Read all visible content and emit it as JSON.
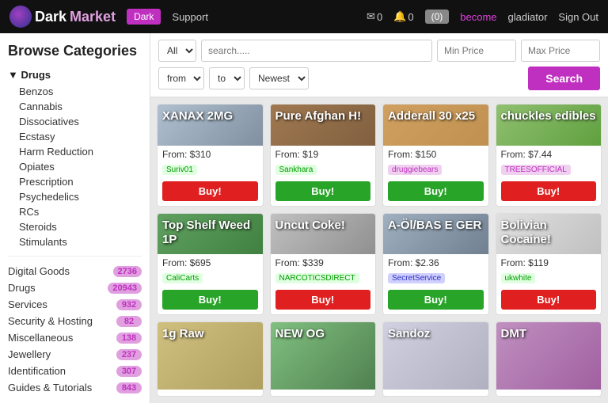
{
  "header": {
    "logo_dark": "Dark",
    "logo_market": "Market",
    "nav_dark": "Dark",
    "nav_support": "Support",
    "mail_count": "0",
    "bell_count": "0",
    "cart_label": "(0)",
    "become": "become",
    "username": "gladiator",
    "signout": "Sign Out"
  },
  "sidebar": {
    "title": "Browse Categories",
    "drugs_header": "▼ Drugs",
    "drug_items": [
      "Benzos",
      "Cannabis",
      "Dissociatives",
      "Ecstasy",
      "Harm Reduction",
      "Opiates",
      "Prescription",
      "Psychedelics",
      "RCs",
      "Steroids",
      "Stimulants"
    ],
    "categories": [
      {
        "label": "Digital Goods",
        "count": "2736"
      },
      {
        "label": "Drugs",
        "count": "20943"
      },
      {
        "label": "Services",
        "count": "932"
      },
      {
        "label": "Security & Hosting",
        "count": "82"
      },
      {
        "label": "Miscellaneous",
        "count": "138"
      },
      {
        "label": "Jewellery",
        "count": "237"
      },
      {
        "label": "Identification",
        "count": "307"
      },
      {
        "label": "Guides & Tutorials",
        "count": "843"
      }
    ]
  },
  "search": {
    "category_default": "All",
    "placeholder": "search.....",
    "min_price_placeholder": "Min Price",
    "max_price_placeholder": "Max Price",
    "from_default": "from",
    "to_default": "to",
    "sort_default": "Newest",
    "button_label": "Search"
  },
  "products": [
    {
      "title": "XANAX 2MG",
      "price": "From: $310",
      "seller": "Suriv01",
      "seller_style": "green",
      "buy_label": "Buy!",
      "buy_style": "red",
      "img_class": "img-bg-xanax"
    },
    {
      "title": "Pure Afghan H!",
      "price": "From: $19",
      "seller": "Sankhara",
      "seller_style": "green",
      "buy_label": "Buy!",
      "buy_style": "green",
      "img_class": "img-bg-afghan"
    },
    {
      "title": "Adderall 30 x25",
      "price": "From: $150",
      "seller": "druggiebears",
      "seller_style": "purple",
      "buy_label": "Buy!",
      "buy_style": "green",
      "img_class": "img-bg-adderall"
    },
    {
      "title": "chuckles edibles",
      "price": "From: $7.44",
      "seller": "TREESOFFICIAL",
      "seller_style": "purple",
      "buy_label": "Buy!",
      "buy_style": "red",
      "img_class": "img-bg-chuckles"
    },
    {
      "title": "Top Shelf Weed 1P",
      "price": "From: $695",
      "seller": "CaliCarts",
      "seller_style": "green",
      "buy_label": "Buy!",
      "buy_style": "green",
      "img_class": "img-bg-topshelf"
    },
    {
      "title": "Uncut Coke!",
      "price": "From: $339",
      "seller": "NARCOTICSDIRECT",
      "seller_style": "green",
      "buy_label": "Buy!",
      "buy_style": "red",
      "img_class": "img-bg-uncut"
    },
    {
      "title": "A-Öl/BAS E GER",
      "price": "From: $2.36",
      "seller": "SecretService",
      "seller_style": "blue",
      "buy_label": "Buy!",
      "buy_style": "green",
      "img_class": "img-bg-ager"
    },
    {
      "title": "Bolivian Cocaine!",
      "price": "From: $119",
      "seller": "ukwhite",
      "seller_style": "green",
      "buy_label": "Buy!",
      "buy_style": "red",
      "img_class": "img-bg-bolivian"
    },
    {
      "title": "1g Raw",
      "price": "",
      "seller": "",
      "seller_style": "green",
      "buy_label": "",
      "buy_style": "green",
      "img_class": "img-bg-1graw"
    },
    {
      "title": "NEW OG",
      "price": "",
      "seller": "",
      "seller_style": "green",
      "buy_label": "",
      "buy_style": "green",
      "img_class": "img-bg-newog"
    },
    {
      "title": "Sandoz",
      "price": "",
      "seller": "",
      "seller_style": "green",
      "buy_label": "",
      "buy_style": "green",
      "img_class": "img-bg-sandoz"
    },
    {
      "title": "DMT",
      "price": "",
      "seller": "",
      "seller_style": "green",
      "buy_label": "",
      "buy_style": "green",
      "img_class": "img-bg-dmt"
    }
  ]
}
